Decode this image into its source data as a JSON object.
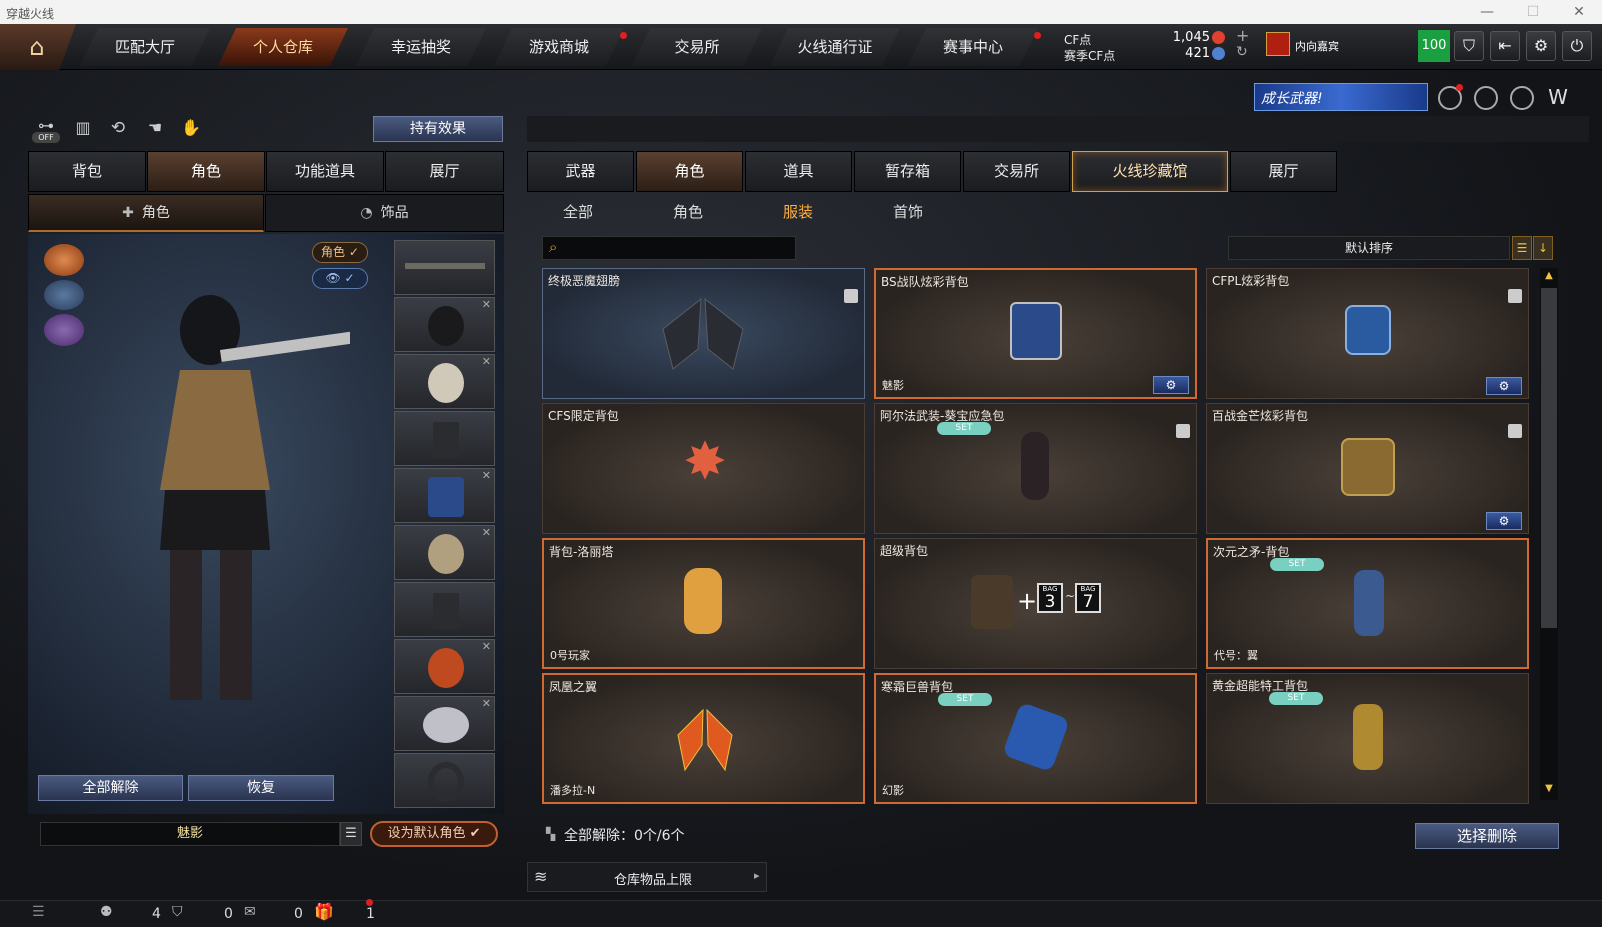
{
  "window": {
    "title": "穿越火线"
  },
  "nav": {
    "tabs": [
      {
        "label": "匹配大厅"
      },
      {
        "label": "个人仓库"
      },
      {
        "label": "幸运抽奖"
      },
      {
        "label": "游戏商城"
      },
      {
        "label": "交易所"
      },
      {
        "label": "火线通行证"
      },
      {
        "label": "赛事中心"
      }
    ],
    "cf_label": "CF点",
    "cf_value": "1,045",
    "season_label": "赛季CF点",
    "season_value": "421",
    "username": "内向嘉宾",
    "level": "100"
  },
  "banner": {
    "text": "成长武器!"
  },
  "left": {
    "hold_effect": "持有效果",
    "off_label": "OFF",
    "tabs": [
      {
        "label": "背包"
      },
      {
        "label": "角色"
      },
      {
        "label": "功能道具"
      },
      {
        "label": "展厅"
      }
    ],
    "subtabs": [
      {
        "label": "角色"
      },
      {
        "label": "饰品"
      }
    ],
    "role_pill": "角色",
    "btn_release_all": "全部解除",
    "btn_restore": "恢复",
    "char_name": "魅影",
    "btn_set_default": "设为默认角色"
  },
  "right": {
    "tabs": [
      {
        "label": "武器"
      },
      {
        "label": "角色"
      },
      {
        "label": "道具"
      },
      {
        "label": "暂存箱"
      },
      {
        "label": "交易所"
      },
      {
        "label": "火线珍藏馆"
      },
      {
        "label": "展厅"
      }
    ],
    "subtabs": [
      {
        "label": "全部"
      },
      {
        "label": "角色"
      },
      {
        "label": "服装"
      },
      {
        "label": "首饰"
      }
    ],
    "search_placeholder": "",
    "sort_label": "默认排序",
    "set_badge": "SET",
    "items": [
      {
        "title": "终极恶魔翅膀",
        "tag": ""
      },
      {
        "title": "BS战队炫彩背包",
        "tag": "魅影"
      },
      {
        "title": "CFPL炫彩背包",
        "tag": ""
      },
      {
        "title": "CFS限定背包",
        "tag": ""
      },
      {
        "title": "阿尔法武装-葵宝应急包",
        "tag": ""
      },
      {
        "title": "百战金芒炫彩背包",
        "tag": ""
      },
      {
        "title": "背包-洛丽塔",
        "tag": "0号玩家"
      },
      {
        "title": "超级背包",
        "tag": ""
      },
      {
        "title": "次元之矛-背包",
        "tag": "代号：翼"
      },
      {
        "title": "凤凰之翼",
        "tag": "潘多拉-N"
      },
      {
        "title": "寒霜巨兽背包",
        "tag": "幻影"
      },
      {
        "title": "黄金超能特工背包",
        "tag": ""
      }
    ],
    "bag_left": "3",
    "bag_right": "7",
    "bag_small": "BAG",
    "release_status": "全部解除：0个/6个",
    "btn_select_delete": "选择删除",
    "storage_limit": "仓库物品上限"
  },
  "bottom": {
    "count1": "4",
    "count2": "0",
    "count3": "0",
    "count4": "1"
  }
}
